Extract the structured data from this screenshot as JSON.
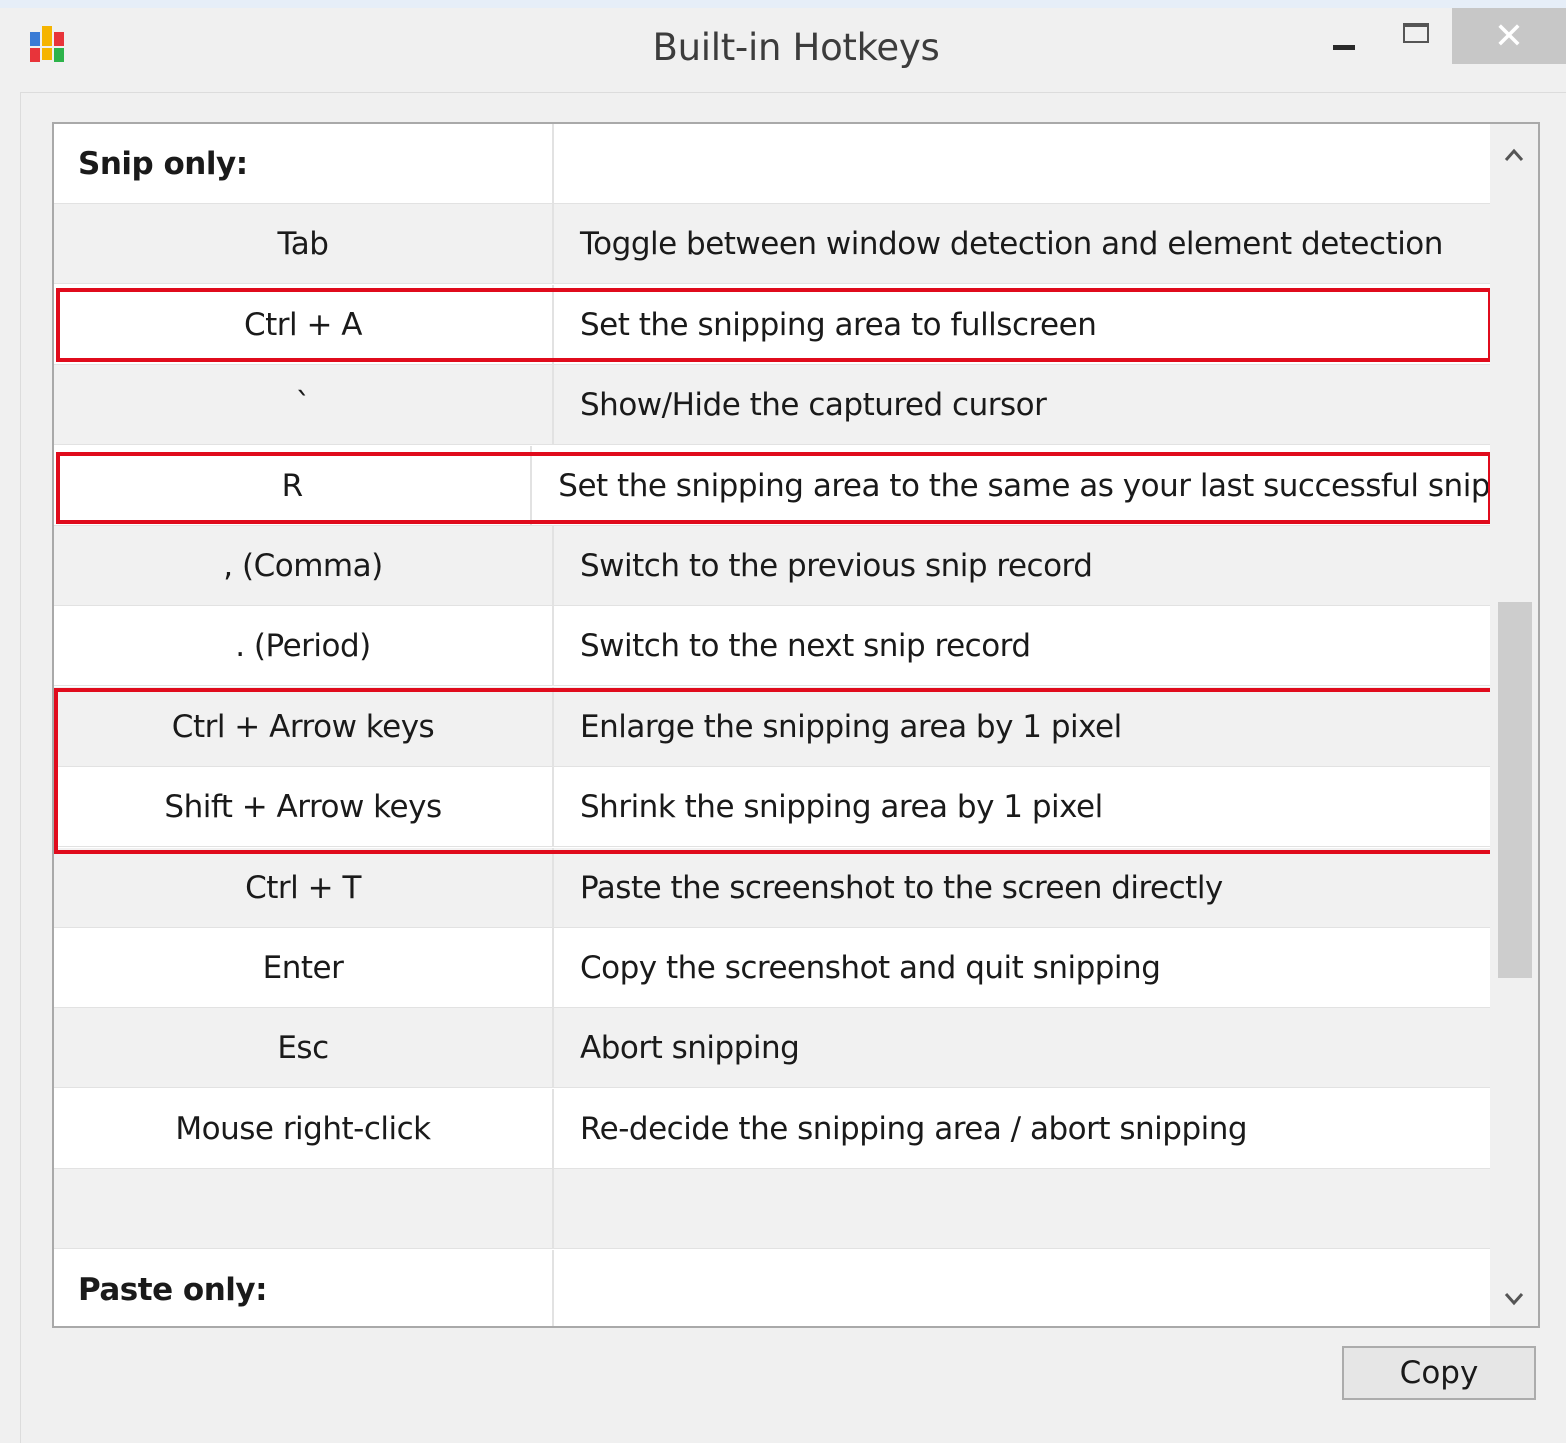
{
  "window": {
    "title": "Built-in Hotkeys",
    "close_glyph": "✕",
    "icon": "app-logo-icon"
  },
  "hotkeys_table": {
    "rows": [
      {
        "key": "Snip only:",
        "description": "",
        "type": "section"
      },
      {
        "key": "Tab",
        "description": "Toggle between window detection and element detection"
      },
      {
        "key": "Ctrl + A",
        "description": "Set the snipping area to fullscreen",
        "highlighted": true
      },
      {
        "key": "`",
        "description": "Show/Hide the captured cursor"
      },
      {
        "key": "R",
        "description": "Set the snipping area to the same as your last successful snip",
        "highlighted": true
      },
      {
        "key": ", (Comma)",
        "description": "Switch to the previous snip record"
      },
      {
        "key": ". (Period)",
        "description": "Switch to the next snip record"
      },
      {
        "key": "Ctrl + Arrow keys",
        "description": "Enlarge the snipping area by 1 pixel",
        "highlighted": true
      },
      {
        "key": "Shift + Arrow keys",
        "description": "Shrink the snipping area by 1 pixel",
        "highlighted": true
      },
      {
        "key": "Ctrl + T",
        "description": "Paste the screenshot to the screen directly"
      },
      {
        "key": "Enter",
        "description": "Copy the screenshot and quit snipping"
      },
      {
        "key": "Esc",
        "description": "Abort snipping"
      },
      {
        "key": "Mouse right-click",
        "description": "Re-decide the snipping area / abort snipping"
      },
      {
        "key": "",
        "description": ""
      },
      {
        "key": "Paste only:",
        "description": "",
        "type": "section"
      }
    ]
  },
  "footer": {
    "copy_label": "Copy"
  },
  "colors": {
    "highlight": "#e00b1c",
    "row_alt": "#f1f1f1",
    "window_bg": "#f0f0f0"
  }
}
